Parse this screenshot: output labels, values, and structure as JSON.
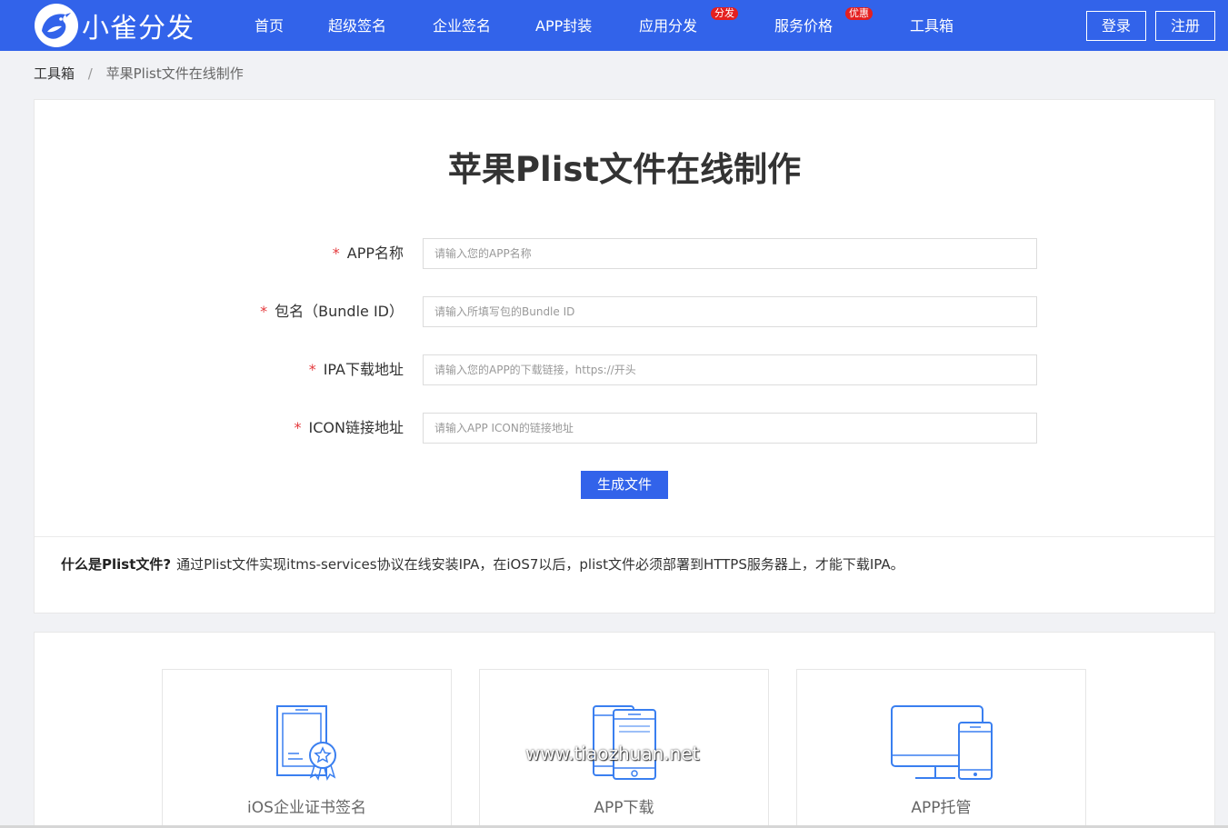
{
  "nav": {
    "brand": "小雀分发",
    "items": [
      {
        "label": "首页"
      },
      {
        "label": "超级签名"
      },
      {
        "label": "企业签名"
      },
      {
        "label": "APP封装"
      },
      {
        "label": "应用分发",
        "badge": "分发"
      },
      {
        "label": "服务价格",
        "badge": "优惠"
      },
      {
        "label": "工具箱"
      }
    ],
    "login_label": "登录",
    "register_label": "注册"
  },
  "breadcrumb": {
    "root": "工具箱",
    "separator": "/",
    "current": "苹果Plist文件在线制作"
  },
  "form": {
    "title": "苹果Plist文件在线制作",
    "required_mark": "*",
    "fields": [
      {
        "label": "APP名称",
        "value": "",
        "placeholder": "请输入您的APP名称"
      },
      {
        "label": "包名（Bundle ID）",
        "value": "",
        "placeholder": "请输入所填写包的Bundle ID"
      },
      {
        "label": "IPA下载地址",
        "value": "",
        "placeholder": "请输入您的APP的下载链接，https://开头"
      },
      {
        "label": "ICON链接地址",
        "value": "",
        "placeholder": "请输入APP ICON的链接地址"
      }
    ],
    "submit_label": "生成文件"
  },
  "faq": {
    "question": "什么是Plist文件?",
    "answer": "通过Plist文件实现itms-services协议在线安装IPA，在iOS7以后，plist文件必须部署到HTTPS服务器上，才能下载IPA。"
  },
  "features": [
    {
      "label": "iOS企业证书签名",
      "icon": "certificate-icon"
    },
    {
      "label": "APP下载",
      "icon": "mobile-devices-icon"
    },
    {
      "label": "APP托管",
      "icon": "desktop-mobile-icon"
    }
  ],
  "watermark": "www.tiaozhuan.net",
  "colors": {
    "brand": "#3263ea",
    "badge": "#e41f1f",
    "required": "#e4393c",
    "page_bg": "#f1f2f5",
    "icon_stroke": "#3a7ff0"
  }
}
